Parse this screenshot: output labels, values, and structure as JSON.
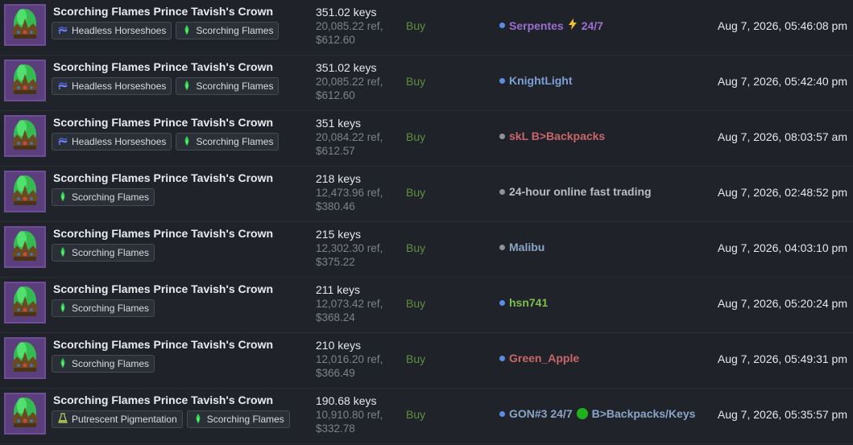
{
  "listings": [
    {
      "item_name": "Scorching Flames Prince Tavish's Crown",
      "attributes": [
        {
          "label": "Headless Horseshoes",
          "icon": "horseshoe-icon"
        },
        {
          "label": "Scorching Flames",
          "icon": "flame-icon"
        }
      ],
      "keys": "351.02 keys",
      "ref": "20,085.22 ref,",
      "usd": "$612.60",
      "intent": "Buy",
      "seller": {
        "dot_color": "#5a8ee6",
        "name": "Serpentes",
        "name_color": "#9a6fd0",
        "suffix": "24/7",
        "suffix_color": "#9a6fd0",
        "has_bolt": true
      },
      "time": "Aug 7, 2026, 05:46:08 pm"
    },
    {
      "item_name": "Scorching Flames Prince Tavish's Crown",
      "attributes": [
        {
          "label": "Headless Horseshoes",
          "icon": "horseshoe-icon"
        },
        {
          "label": "Scorching Flames",
          "icon": "flame-icon"
        }
      ],
      "keys": "351.02 keys",
      "ref": "20,085.22 ref,",
      "usd": "$612.60",
      "intent": "Buy",
      "seller": {
        "dot_color": "#5a8ee6",
        "name": "KnightLight",
        "name_color": "#7c9fd6"
      },
      "time": "Aug 7, 2026, 05:42:40 pm"
    },
    {
      "item_name": "Scorching Flames Prince Tavish's Crown",
      "attributes": [
        {
          "label": "Headless Horseshoes",
          "icon": "horseshoe-icon"
        },
        {
          "label": "Scorching Flames",
          "icon": "flame-icon"
        }
      ],
      "keys": "351 keys",
      "ref": "20,084.22 ref,",
      "usd": "$612.57",
      "intent": "Buy",
      "seller": {
        "dot_color": "#8f9398",
        "name": "skL B>Backpacks",
        "name_color": "#c9666a"
      },
      "time": "Aug 7, 2026, 08:03:57 am"
    },
    {
      "item_name": "Scorching Flames Prince Tavish's Crown",
      "attributes": [
        {
          "label": "Scorching Flames",
          "icon": "flame-icon"
        }
      ],
      "keys": "218 keys",
      "ref": "12,473.96 ref,",
      "usd": "$380.46",
      "intent": "Buy",
      "seller": {
        "dot_color": "#8f9398",
        "name": "24-hour online fast trading",
        "name_color": "#b9bdc2"
      },
      "time": "Aug 7, 2026, 02:48:52 pm"
    },
    {
      "item_name": "Scorching Flames Prince Tavish's Crown",
      "attributes": [
        {
          "label": "Scorching Flames",
          "icon": "flame-icon"
        }
      ],
      "keys": "215 keys",
      "ref": "12,302.30 ref,",
      "usd": "$375.22",
      "intent": "Buy",
      "seller": {
        "dot_color": "#8f9398",
        "name": "Malibu",
        "name_color": "#8aa4c6"
      },
      "time": "Aug 7, 2026, 04:03:10 pm"
    },
    {
      "item_name": "Scorching Flames Prince Tavish's Crown",
      "attributes": [
        {
          "label": "Scorching Flames",
          "icon": "flame-icon"
        }
      ],
      "keys": "211 keys",
      "ref": "12,073.42 ref,",
      "usd": "$368.24",
      "intent": "Buy",
      "seller": {
        "dot_color": "#5a8ee6",
        "name": "hsn741",
        "name_color": "#7cbf4a"
      },
      "time": "Aug 7, 2026, 05:20:24 pm"
    },
    {
      "item_name": "Scorching Flames Prince Tavish's Crown",
      "attributes": [
        {
          "label": "Scorching Flames",
          "icon": "flame-icon"
        }
      ],
      "keys": "210 keys",
      "ref": "12,016.20 ref,",
      "usd": "$366.49",
      "intent": "Buy",
      "seller": {
        "dot_color": "#5a8ee6",
        "name": "Green_Apple",
        "name_color": "#c9666a"
      },
      "time": "Aug 7, 2026, 05:49:31 pm"
    },
    {
      "item_name": "Scorching Flames Prince Tavish's Crown",
      "attributes": [
        {
          "label": "Putrescent Pigmentation",
          "icon": "paint-can-icon"
        },
        {
          "label": "Scorching Flames",
          "icon": "flame-icon"
        }
      ],
      "keys": "190.68 keys",
      "ref": "10,910.80 ref,",
      "usd": "$332.78",
      "intent": "Buy",
      "seller": {
        "dot_color": "#5a8ee6",
        "name": "GON#3 24/7",
        "name_color": "#8aa4c6",
        "suffix": "B>Backpacks/Keys",
        "suffix_color": "#8aa4c6",
        "has_green_dot": true
      },
      "time": "Aug 7, 2026, 05:35:57 pm"
    }
  ]
}
